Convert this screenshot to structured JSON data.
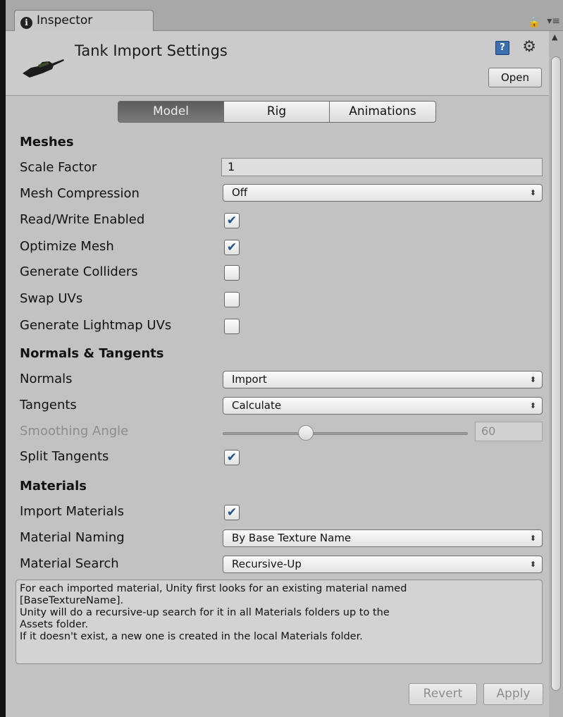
{
  "window": {
    "tab_label": "Inspector"
  },
  "header": {
    "title": "Tank Import Settings",
    "open_label": "Open",
    "help_glyph": "?"
  },
  "tabs": [
    {
      "label": "Model",
      "active": true
    },
    {
      "label": "Rig",
      "active": false
    },
    {
      "label": "Animations",
      "active": false
    }
  ],
  "meshes": {
    "heading": "Meshes",
    "scale_factor": {
      "label": "Scale Factor",
      "value": "1"
    },
    "mesh_compression": {
      "label": "Mesh Compression",
      "value": "Off"
    },
    "read_write": {
      "label": "Read/Write Enabled",
      "checked": true
    },
    "optimize_mesh": {
      "label": "Optimize Mesh",
      "checked": true
    },
    "generate_colliders": {
      "label": "Generate Colliders",
      "checked": false
    },
    "swap_uvs": {
      "label": "Swap UVs",
      "checked": false
    },
    "lightmap_uvs": {
      "label": "Generate Lightmap UVs",
      "checked": false
    }
  },
  "normals": {
    "heading": "Normals & Tangents",
    "normals": {
      "label": "Normals",
      "value": "Import"
    },
    "tangents": {
      "label": "Tangents",
      "value": "Calculate"
    },
    "smoothing_angle": {
      "label": "Smoothing Angle",
      "value": "60",
      "slider_fraction": 0.34
    },
    "split_tangents": {
      "label": "Split Tangents",
      "checked": true
    }
  },
  "materials": {
    "heading": "Materials",
    "import_materials": {
      "label": "Import Materials",
      "checked": true
    },
    "material_naming": {
      "label": "Material Naming",
      "value": "By Base Texture Name"
    },
    "material_search": {
      "label": "Material Search",
      "value": "Recursive-Up"
    }
  },
  "help_text": [
    "For each imported material, Unity first looks for an existing material named",
    "[BaseTextureName].",
    "Unity will do a recursive-up search for it in all Materials folders up to the",
    "Assets folder.",
    "If it doesn't exist, a new one is created in the local Materials folder."
  ],
  "buttons": {
    "revert": "Revert",
    "apply": "Apply"
  },
  "glyphs": {
    "check": "✔",
    "dropdown_arrows": "⬍",
    "info": "i",
    "lock": "🔒",
    "menu": "▾≡",
    "gear": "⚙",
    "scroll_up": "▲"
  }
}
